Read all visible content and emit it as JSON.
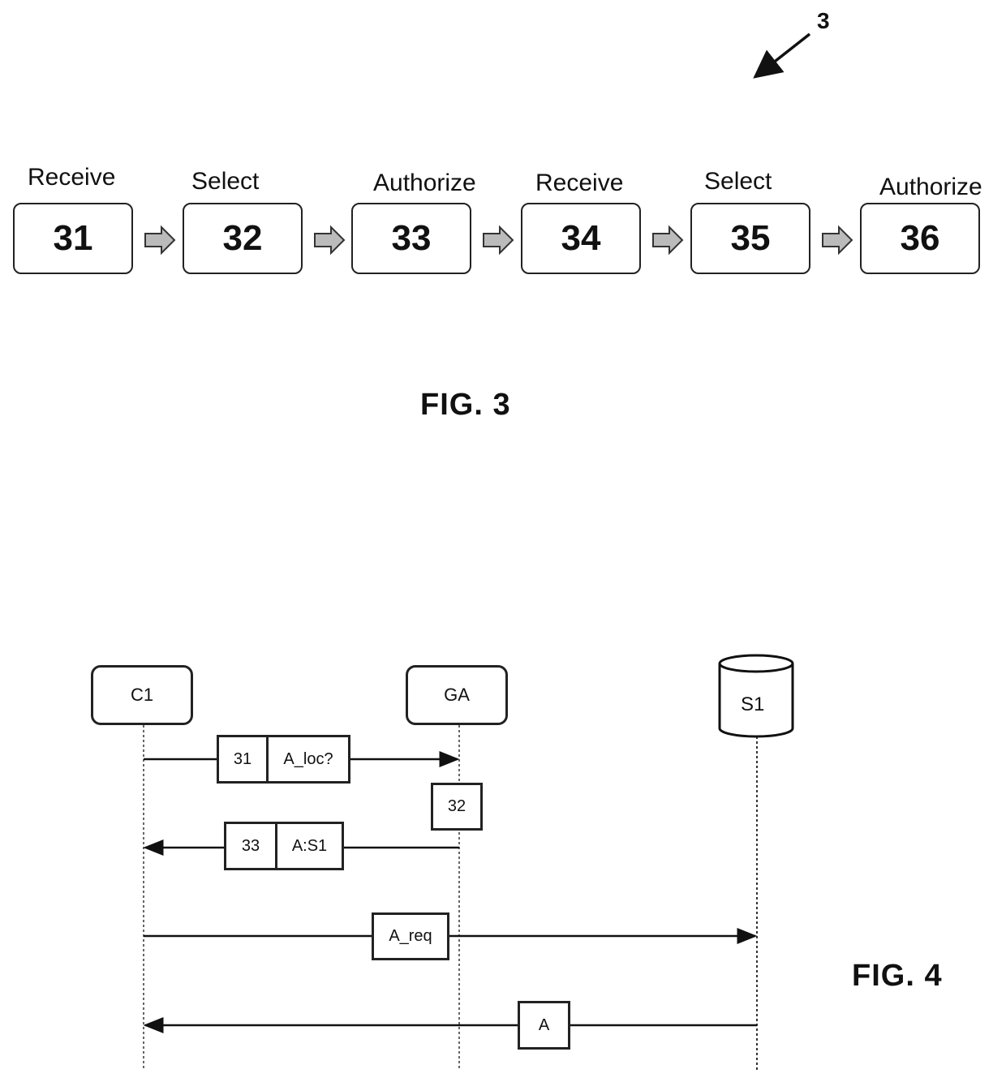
{
  "fig3": {
    "reference_numeral": "3",
    "caption": "FIG. 3",
    "steps": [
      {
        "label": "Receive",
        "number": "31"
      },
      {
        "label": "Select",
        "number": "32"
      },
      {
        "label": "Authorize",
        "number": "33"
      },
      {
        "label": "Receive",
        "number": "34"
      },
      {
        "label": "Select",
        "number": "35"
      },
      {
        "label": "Authorize",
        "number": "36"
      }
    ]
  },
  "fig4": {
    "caption": "FIG. 4",
    "actors": [
      {
        "id": "C1",
        "label": "C1",
        "shape": "rounded-box"
      },
      {
        "id": "GA",
        "label": "GA",
        "shape": "rounded-box"
      },
      {
        "id": "S1",
        "label": "S1",
        "shape": "cylinder"
      }
    ],
    "messages": [
      {
        "from": "C1",
        "to": "GA",
        "step": "31",
        "label": "A_loc?"
      },
      {
        "at": "GA",
        "step": "32",
        "label": ""
      },
      {
        "from": "GA",
        "to": "C1",
        "step": "33",
        "label": "A:S1"
      },
      {
        "from": "C1",
        "to": "S1",
        "step": "",
        "label": "A_req"
      },
      {
        "from": "S1",
        "to": "C1",
        "step": "",
        "label": "A"
      }
    ]
  }
}
